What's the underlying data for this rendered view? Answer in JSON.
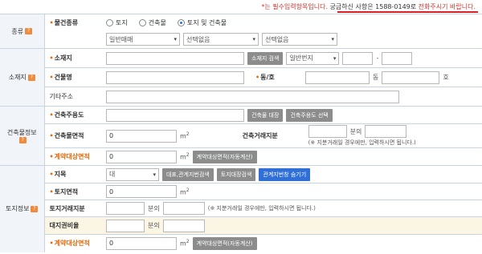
{
  "notice": {
    "prefix": "*는 필수입력항목입니다. ",
    "highlight": "궁금하신 사항은 1588-0149로",
    "suffix": " 전화주시기 바랍니다."
  },
  "sections": {
    "type": "종류",
    "location": "소재지",
    "building": "건축물정보",
    "land": "토지정보"
  },
  "help_icon": "?",
  "type_section": {
    "label": "물건종류",
    "radios": [
      "토지",
      "건축물",
      "토지 및 건축물"
    ],
    "selected": "토지 및 건축물",
    "selects": [
      "일반매매",
      "선택없음",
      "선택없음"
    ]
  },
  "location_section": {
    "address_label": "소재지",
    "address_search_btn": "소재지 검색",
    "lot_select": "일반번지",
    "lot_sep": "-",
    "building_name_label": "건물명",
    "dong_ho_label": "동/호",
    "dong_unit": "동",
    "ho_unit": "호",
    "other_address_label": "기타주소"
  },
  "building_section": {
    "usage_label": "건축주용도",
    "ledger_btn": "건축물 대장",
    "usage_select_btn": "건축주용도 선택",
    "area_label": "건축물면적",
    "area_value": "0",
    "unit_m": "m",
    "unit_sup": "2",
    "share_label": "건축거래지분",
    "share_sep": "분의",
    "share_note": "(※ 지분거래일 경우에만, 입력하시면 됩니다.)",
    "contract_area_label": "계약대상면적",
    "contract_area_value": "0",
    "auto_calc_btn": "계약대상면적(자동계산)"
  },
  "land_section": {
    "category_label": "지목",
    "category_value": "대",
    "parcel_search_btn": "대표,관계지번검색",
    "land_ledger_btn": "토지대장검색",
    "hide_btn": "관계지번창 숨기기",
    "area_label": "토지면적",
    "area_value": "0",
    "share_label": "토지거래지분",
    "share_sep": "분의",
    "share_note": "(※ 지분거래일 경우에만, 입력하시면 됩니다.)",
    "right_ratio_label": "대지권비율",
    "right_ratio_sep": "분의",
    "contract_area_label": "계약대상면적",
    "contract_area_value": "0",
    "auto_calc_btn": "계약대상면적(자동계산)"
  },
  "required_mark": "•",
  "chevron": "▾",
  "colors": {
    "required": "#e06a0a",
    "accent_blue": "#2f6fd6",
    "notice_red": "#d0342c"
  }
}
